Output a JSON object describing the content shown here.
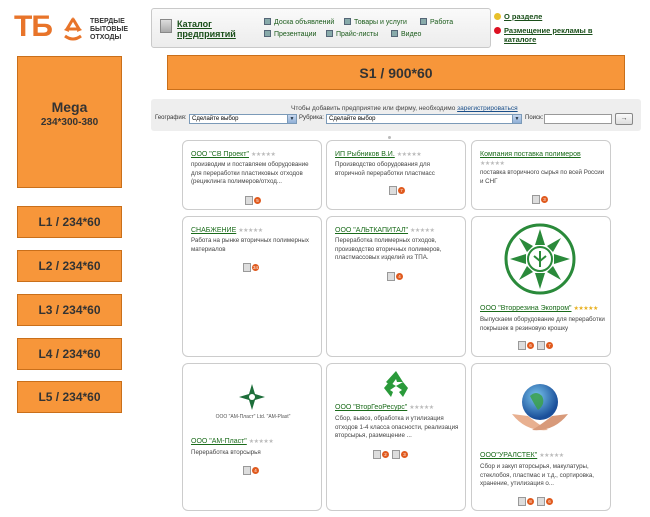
{
  "logo": {
    "mark": "ТБ",
    "lines": [
      "ТВЕРДЫЕ",
      "БЫТОВЫЕ",
      "ОТХОДЫ"
    ]
  },
  "nav": {
    "catalog_line1": "Каталог",
    "catalog_line2": "предприятий",
    "links": [
      "Доска объявлений",
      "Товары и услуги",
      "Работа",
      "Презентации",
      "Прайс-листы",
      "Видео"
    ]
  },
  "topright": {
    "about": "О разделе",
    "ads_line1": "Размещение рекламы в",
    "ads_line2": "каталоге"
  },
  "banners": {
    "mega_title": "Mega",
    "mega_size": "234*300-380",
    "s1": "S1 / 900*60",
    "left": [
      "L1 / 234*60",
      "L2 / 234*60",
      "L3 / 234*60",
      "L4 / 234*60",
      "L5 / 234*60"
    ]
  },
  "search": {
    "note_text": "Чтобы добавить предприятие или фирму, необходимо",
    "note_link": "зарегистрироваться",
    "geo_label": "География:",
    "geo_value": "Сделайте выбор",
    "rubric_label": "Рубрика:",
    "rubric_value": "Сделайте выбор",
    "search_label": "Поиск:",
    "search_value": "",
    "go_label": "→"
  },
  "colors": {
    "banner": "#f7963a",
    "link": "#1a6b1a",
    "badge": "#e05a1e"
  },
  "cards": [
    {
      "title": "ООО \"СВ Проект\"",
      "rating": 0,
      "desc": "производим и поставляем оборудование для переработки пластиковых отходов (рециклинга полимеров/отход...",
      "badges": [
        "5"
      ]
    },
    {
      "title": "ИП Рыбников В.И.",
      "rating": 0,
      "desc": "Производство оборудования для вторичной переработки пластмасс",
      "badges": [
        "7"
      ]
    },
    {
      "title": "Компания поставка полимеров",
      "rating": 0,
      "desc": "поставка вторичного сырья по всей России и СНГ",
      "badges": [
        "3"
      ]
    },
    {
      "title": "СНАБЖЕНИЕ",
      "rating": 0,
      "desc": "Работа на рынке вторичных полимерных материалов",
      "badges": [
        "34"
      ]
    },
    {
      "title": "ООО \"АЛЬТКАПИТАЛ\"",
      "rating": 0,
      "desc": "Переработка полимерных отходов, производство вторичных полимеров, пластмассовых изделий из ТПА.",
      "badges": [
        "4"
      ]
    },
    {
      "title": "ООО \"Вторрезина Экопром\"",
      "rating": 5,
      "desc": "Выпускаем оборудование для переработки покрышек в резиновую крошку",
      "badges": [
        "6",
        "7"
      ]
    },
    {
      "title": "ООО \"АМ-Пласт\"",
      "rating": 0,
      "desc": "Переработка вторсырья",
      "badges": [
        "4"
      ],
      "logo_text": "ООО \"АМ-Пласт\" Ltd. \"AM-Plast\""
    },
    {
      "title": "ООО \"ВторГеоРесурс\"",
      "rating": 0,
      "desc": "Сбор, вывоз, обработка и утилизация отходов 1-4 класса опасности, реализация вторсырья, размещение ...",
      "badges": [
        "2",
        "3"
      ]
    },
    {
      "title": "ООО\"УРАЛСТЕК\"",
      "rating": 0,
      "desc": "Сбор и закуп вторсырья, макулатуры, стеклобоя, пластмас и т.д., сортировка, хранение, утилизация о...",
      "badges": [
        "8",
        "6"
      ]
    }
  ]
}
